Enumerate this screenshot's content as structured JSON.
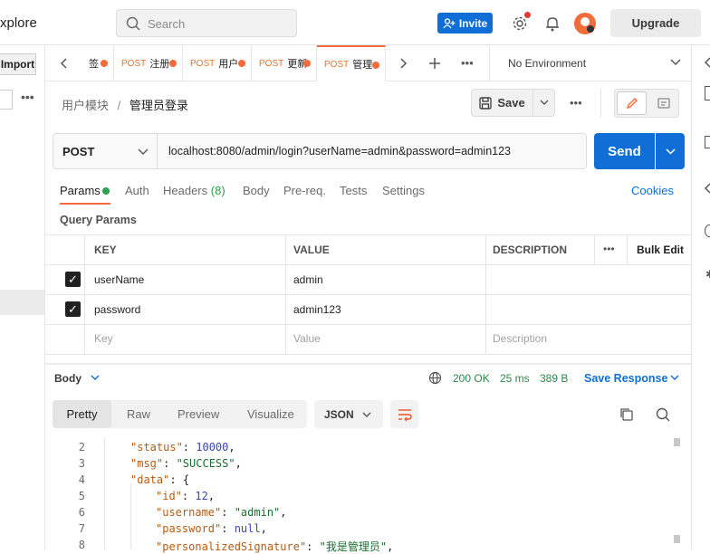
{
  "app": {
    "explore_label": "xplore",
    "search_placeholder": "Search",
    "invite_label": "Invite",
    "upgrade_label": "Upgrade"
  },
  "sidebar": {
    "import_label": "Import"
  },
  "tabs": [
    {
      "method": "",
      "name": "签"
    },
    {
      "method": "POST",
      "name": "注册"
    },
    {
      "method": "POST",
      "name": "用户"
    },
    {
      "method": "POST",
      "name": "更新"
    },
    {
      "method": "POST",
      "name": "管理"
    }
  ],
  "environment": "No Environment",
  "breadcrumb": {
    "parent": "用户模块",
    "separator": "/",
    "current": "管理员登录"
  },
  "toolbar": {
    "save_label": "Save"
  },
  "request": {
    "method": "POST",
    "url": "localhost:8080/admin/login?userName=admin&password=admin123",
    "send_label": "Send"
  },
  "req_tabs": {
    "params": "Params",
    "auth": "Auth",
    "headers": "Headers",
    "headers_count": "(8)",
    "body": "Body",
    "prereq": "Pre-req.",
    "tests": "Tests",
    "settings": "Settings",
    "cookies": "Cookies"
  },
  "query_params": {
    "title": "Query Params",
    "columns": {
      "key": "KEY",
      "value": "VALUE",
      "description": "DESCRIPTION",
      "bulk_edit": "Bulk Edit"
    },
    "rows": [
      {
        "key": "userName",
        "value": "admin",
        "checked": true
      },
      {
        "key": "password",
        "value": "admin123",
        "checked": true
      }
    ],
    "placeholder": {
      "key": "Key",
      "value": "Value",
      "description": "Description"
    }
  },
  "response": {
    "body_label": "Body",
    "status": "200 OK",
    "time": "25 ms",
    "size": "389 B",
    "save_label": "Save Response",
    "view_tabs": [
      "Pretty",
      "Raw",
      "Preview",
      "Visualize"
    ],
    "format": "JSON",
    "lines": [
      {
        "num": "2",
        "indent": 0,
        "key": "\"status\"",
        "val": "10000",
        "vtype": "n",
        "tail": ","
      },
      {
        "num": "3",
        "indent": 0,
        "key": "\"msg\"",
        "val": "\"SUCCESS\"",
        "vtype": "s",
        "tail": ","
      },
      {
        "num": "4",
        "indent": 0,
        "key": "\"data\"",
        "val": "{",
        "vtype": "p",
        "tail": ""
      },
      {
        "num": "5",
        "indent": 1,
        "key": "\"id\"",
        "val": "12",
        "vtype": "n",
        "tail": ","
      },
      {
        "num": "6",
        "indent": 1,
        "key": "\"username\"",
        "val": "\"admin\"",
        "vtype": "s",
        "tail": ","
      },
      {
        "num": "7",
        "indent": 1,
        "key": "\"password\"",
        "val": "null",
        "vtype": "n",
        "tail": ","
      },
      {
        "num": "8",
        "indent": 1,
        "key": "\"personalizedSignature\"",
        "val": "\"我是管理员\"",
        "vtype": "s",
        "tail": ","
      }
    ]
  }
}
